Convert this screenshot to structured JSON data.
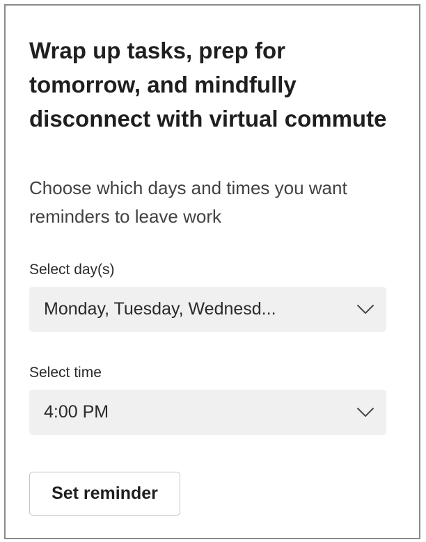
{
  "header": {
    "title": "Wrap up tasks, prep for tomorrow, and mindfully disconnect with virtual commute",
    "subtitle": "Choose which days and times you want reminders to leave work"
  },
  "day_select": {
    "label": "Select day(s)",
    "value": "Monday, Tuesday, Wednesd..."
  },
  "time_select": {
    "label": "Select time",
    "value": "4:00 PM"
  },
  "actions": {
    "set_reminder_label": "Set reminder"
  },
  "icons": {
    "dropdown": "chevron-down-icon"
  },
  "colors": {
    "border": "#8a8a8a",
    "field_bg": "#f0f0f0",
    "text": "#242424"
  }
}
